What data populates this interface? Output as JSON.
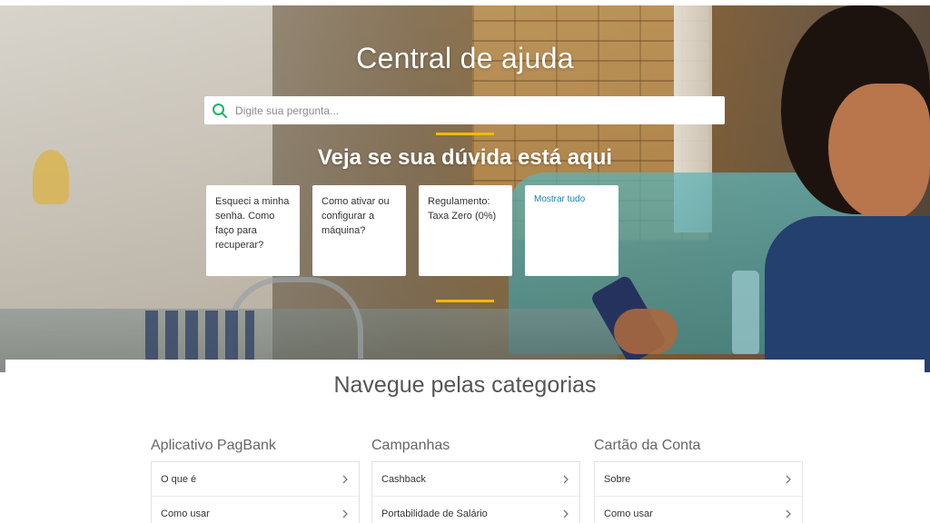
{
  "hero": {
    "title": "Central de ajuda",
    "subtitle": "Veja se sua dúvida está aqui",
    "accent_color": "#f5b800"
  },
  "search": {
    "placeholder": "Digite sua pergunta...",
    "value": "",
    "icon": "search-icon",
    "icon_color": "#1fb36a"
  },
  "faq": [
    {
      "label": "Esqueci a minha senha. Como faço para recuperar?"
    },
    {
      "label": "Como ativar ou configurar a máquina?"
    },
    {
      "label": "Regulamento: Taxa Zero (0%)"
    },
    {
      "label": "Mostrar tudo",
      "link_color": "#1a7db6"
    }
  ],
  "categories": {
    "heading": "Navegue pelas categorias",
    "columns": [
      {
        "title": "Aplicativo PagBank",
        "items": [
          {
            "label": "O que é"
          },
          {
            "label": "Como usar"
          }
        ]
      },
      {
        "title": "Campanhas",
        "items": [
          {
            "label": "Cashback"
          },
          {
            "label": "Portabilidade de Salário"
          }
        ]
      },
      {
        "title": "Cartão da Conta",
        "items": [
          {
            "label": "Sobre"
          },
          {
            "label": "Como usar"
          }
        ]
      }
    ],
    "item_icon": "chevron-right-icon"
  }
}
